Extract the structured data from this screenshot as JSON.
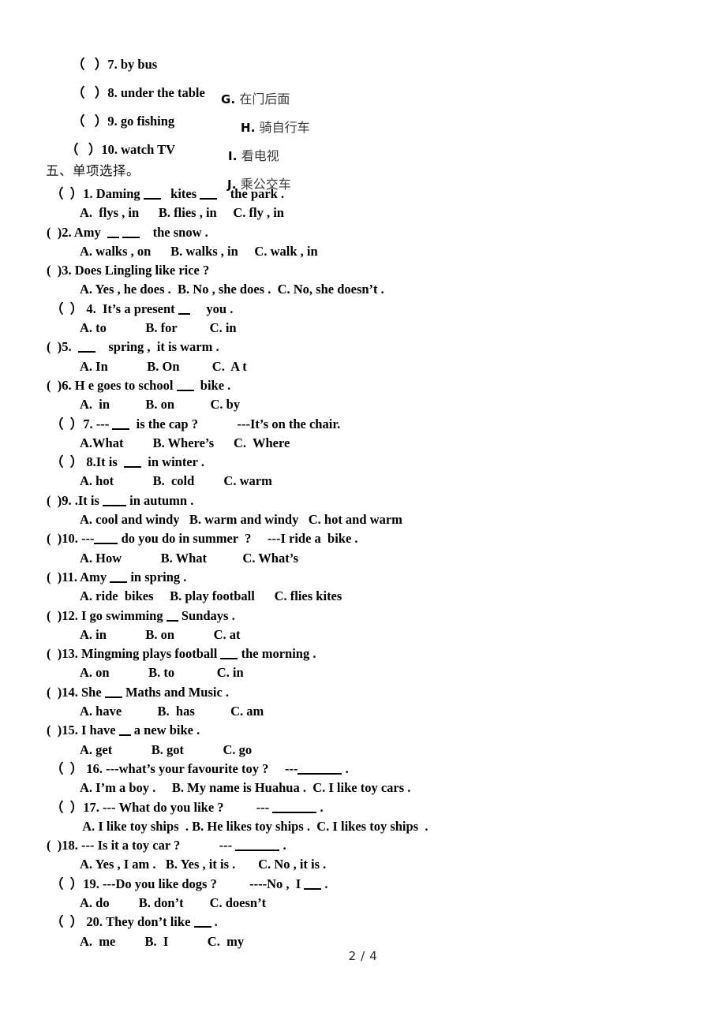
{
  "page": {
    "footer_label": "2 / 4",
    "background": "#ffffff",
    "text_color": "#000000"
  },
  "matching_section": {
    "rows": [
      {
        "paren": "（   ）",
        "number": "7.",
        "english": "by bus",
        "letter": "G.",
        "chinese": "在门后面"
      },
      {
        "paren": "（   ）",
        "number": "8.",
        "english": "under the table",
        "letter": "H.",
        "chinese": "骑自行车"
      },
      {
        "paren": "（   ）",
        "number": "9.",
        "english": "go fishing",
        "letter": "I.",
        "chinese": "看电视"
      },
      {
        "paren": "（   ）",
        "number": "10.",
        "english": "watch TV",
        "letter": "J.",
        "chinese": "乘公交车"
      }
    ]
  },
  "choice_section": {
    "heading": "五、单项选择。",
    "questions": [
      {
        "paren": "（  ）",
        "indent": "wide",
        "stem_a": "1. Daming ",
        "stem_b": "   kites ",
        "stem_c": "    the park .",
        "options": "A.  flys , in      B. flies , in     C. fly , in",
        "options_indent": "ind"
      },
      {
        "paren": "(  )",
        "indent": "tight",
        "stem_a": "2. Amy  ",
        "stem_b": " ",
        "stem_c": "    the snow .",
        "options": "A. walks , on      B. walks , in     C. walk , in",
        "options_indent": "ind"
      },
      {
        "paren": "(  )",
        "indent": "tight",
        "stem_full": "3. Does Lingling like rice ?",
        "options": "A. Yes , he does .  B. No , she does .  C. No, she doesn’t .",
        "options_indent": "ind"
      },
      {
        "paren": "（  ）",
        "indent": "wide",
        "stem_a": " 4.  It’s a present ",
        "stem_c": "     you .",
        "options": "A. to            B. for          C. in",
        "options_indent": "ind"
      },
      {
        "paren": "(  )",
        "indent": "tight",
        "stem_a": "5.  ",
        "stem_c": "    spring ,  it is warm .",
        "options": "A. In            B. On          C.  A t",
        "options_indent": "ind"
      },
      {
        "paren": "(  )",
        "indent": "tight",
        "stem_a": "6. H e goes to school ",
        "stem_c": "  bike .",
        "options": "A.  in           B. on           C. by",
        "options_indent": "ind"
      },
      {
        "paren": "（  ）",
        "indent": "wide",
        "stem_a": "7. --- ",
        "stem_c": "  is the cap ?            ---It’s on the chair.",
        "options": "A.What         B. Where’s      C.  Where",
        "options_indent": "ind"
      },
      {
        "paren": "（  ）",
        "indent": "wide",
        "stem_a": " 8.It is  ",
        "stem_c": "  in winter .",
        "options": "A. hot            B.  cold         C. warm",
        "options_indent": "ind"
      },
      {
        "paren": "(  )",
        "indent": "tight",
        "stem_a": "9. .It is ",
        "stem_c": " in autumn .",
        "options": "A. cool and windy   B. warm and windy   C. hot and warm",
        "options_indent": "ind"
      },
      {
        "paren": "(  )",
        "indent": "tight",
        "stem_a": "10. ---",
        "stem_c": " do you do in summer  ?     ---I ride a  bike .",
        "options": "A. How            B. What           C. What’s",
        "options_indent": "ind"
      },
      {
        "paren": "(  )",
        "indent": "tight",
        "stem_a": "11. Amy ",
        "stem_c": " in spring .",
        "options": "A. ride  bikes     B. play football      C. flies kites",
        "options_indent": "ind"
      },
      {
        "paren": "(  )",
        "indent": "tight",
        "stem_a": "12. I go swimming ",
        "stem_c": " Sundays .",
        "options": "A. in            B. on            C. at",
        "options_indent": "ind"
      },
      {
        "paren": "(  )",
        "indent": "tight",
        "stem_a": "13. Mingming plays football ",
        "stem_c": " the morning .",
        "options": "A. on            B. to             C. in",
        "options_indent": "ind"
      },
      {
        "paren": "(  )",
        "indent": "tight",
        "stem_a": "14. She ",
        "stem_c": " Maths and Music .",
        "options": "A. have           B.  has           C. am",
        "options_indent": "ind"
      },
      {
        "paren": "(  )",
        "indent": "tight",
        "stem_a": "15. I have ",
        "stem_c": " a new bike .",
        "options": "A. get            B. got            C. go",
        "options_indent": "ind"
      },
      {
        "paren": "（  ）",
        "indent": "wide",
        "stem_a": " 16. ---what’s your favourite toy ?     ---",
        "stem_c": " .",
        "options": "A. I’m a boy .     B. My name is Huahua .  C. I like toy cars .",
        "options_indent": "ind"
      },
      {
        "paren": "（  ）",
        "indent": "wide",
        "stem_a": "17. --- What do you like ?          --- ",
        "stem_c": " .",
        "options": " A. I like toy ships  . B. He likes toy ships .  C. I likes toy ships  .",
        "options_indent": "ind"
      },
      {
        "paren": "(  )",
        "indent": "tight",
        "stem_a": "18. --- Is it a toy car ?            --- ",
        "stem_c": " .",
        "options": "A. Yes , I am .   B. Yes , it is .       C. No , it is .",
        "options_indent": "ind"
      },
      {
        "paren": "（  ）",
        "indent": "wide",
        "stem_a": "19. ---Do you like dogs ?          ----No ,  I ",
        "stem_c": " .",
        "options": "A. do         B. don’t        C. doesn’t",
        "options_indent": "ind"
      },
      {
        "paren": "（  ）",
        "indent": "wide",
        "stem_a": " 20. They don’t like ",
        "stem_c": " .",
        "options": "A.  me         B.  I            C.  my",
        "options_indent": "ind"
      }
    ]
  }
}
